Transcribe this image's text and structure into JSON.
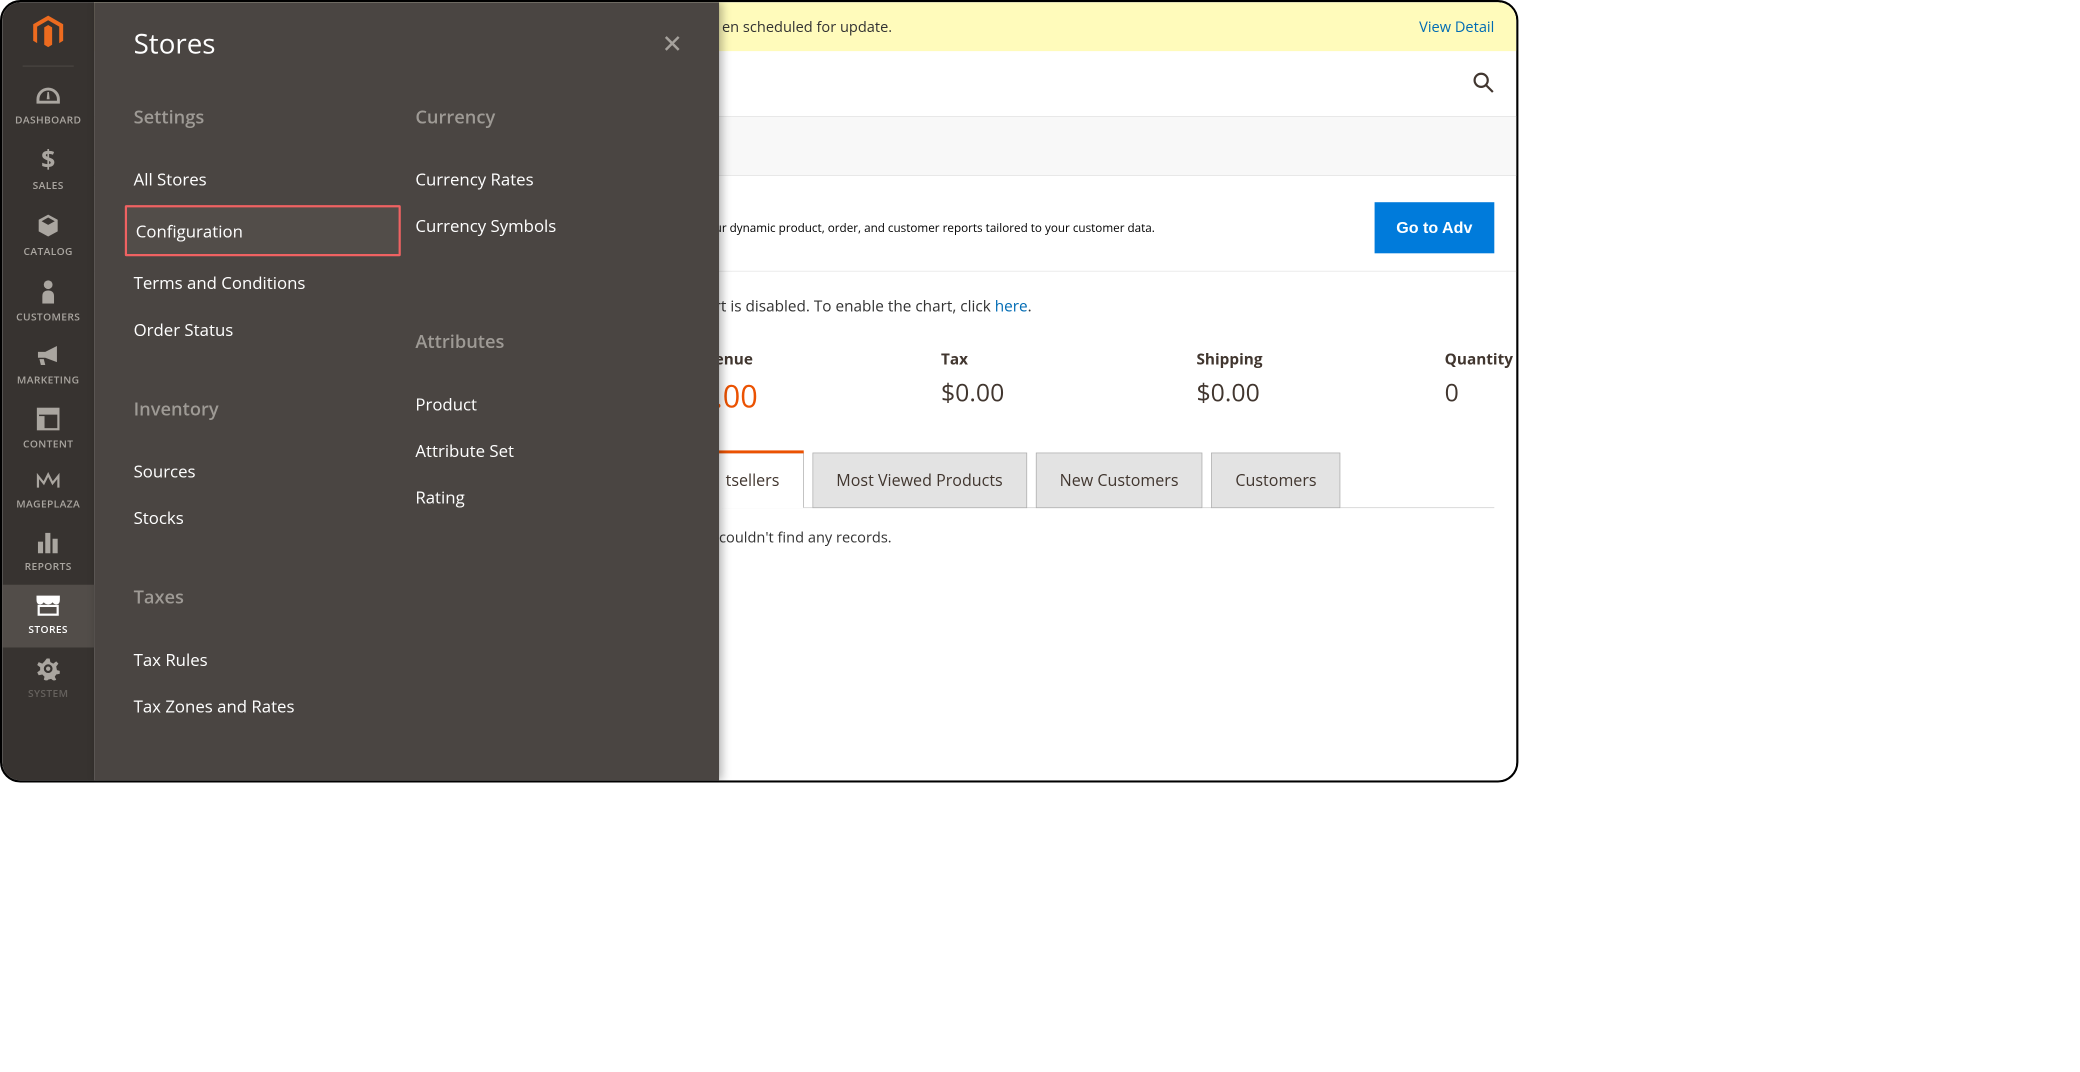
{
  "sidebar": {
    "items": [
      {
        "label": "DASHBOARD",
        "icon": "dashboard"
      },
      {
        "label": "SALES",
        "icon": "dollar"
      },
      {
        "label": "CATALOG",
        "icon": "cube"
      },
      {
        "label": "CUSTOMERS",
        "icon": "person"
      },
      {
        "label": "MARKETING",
        "icon": "megaphone"
      },
      {
        "label": "CONTENT",
        "icon": "layout"
      },
      {
        "label": "MAGEPLAZA",
        "icon": "mageplaza"
      },
      {
        "label": "REPORTS",
        "icon": "bars"
      },
      {
        "label": "STORES",
        "icon": "store"
      },
      {
        "label": "SYSTEM",
        "icon": "gear"
      }
    ]
  },
  "submenu": {
    "title": "Stores",
    "settings": {
      "heading": "Settings",
      "all_stores": "All Stores",
      "configuration": "Configuration",
      "terms": "Terms and Conditions",
      "order_status": "Order Status"
    },
    "inventory": {
      "heading": "Inventory",
      "sources": "Sources",
      "stocks": "Stocks"
    },
    "taxes": {
      "heading": "Taxes",
      "tax_rules": "Tax Rules",
      "tax_zones": "Tax Zones and Rates"
    },
    "currency": {
      "heading": "Currency",
      "rates": "Currency Rates",
      "symbols": "Currency Symbols"
    },
    "attributes": {
      "heading": "Attributes",
      "product": "Product",
      "attribute_set": "Attribute Set",
      "rating": "Rating"
    }
  },
  "notification": {
    "text_suffix": "en scheduled for update.",
    "view_details": "View Detail"
  },
  "reporting": {
    "text_suffix": "ur dynamic product, order, and customer reports tailored to your customer data.",
    "button": "Go to Adv"
  },
  "chart": {
    "text_prefix": "rt is disabled. To enable the chart, click ",
    "link": "here",
    "period": "."
  },
  "kpi": {
    "revenue": {
      "label_suffix": "enue",
      "value": ".00"
    },
    "tax": {
      "label": "Tax",
      "value": "$0.00"
    },
    "shipping": {
      "label": "Shipping",
      "value": "$0.00"
    },
    "quantity": {
      "label": "Quantity",
      "value": "0"
    }
  },
  "tabs": {
    "bestsellers": "tsellers",
    "most_viewed": "Most Viewed Products",
    "new_customers": "New Customers",
    "customers": "Customers"
  },
  "tab_content": {
    "empty": "couldn't find any records."
  }
}
